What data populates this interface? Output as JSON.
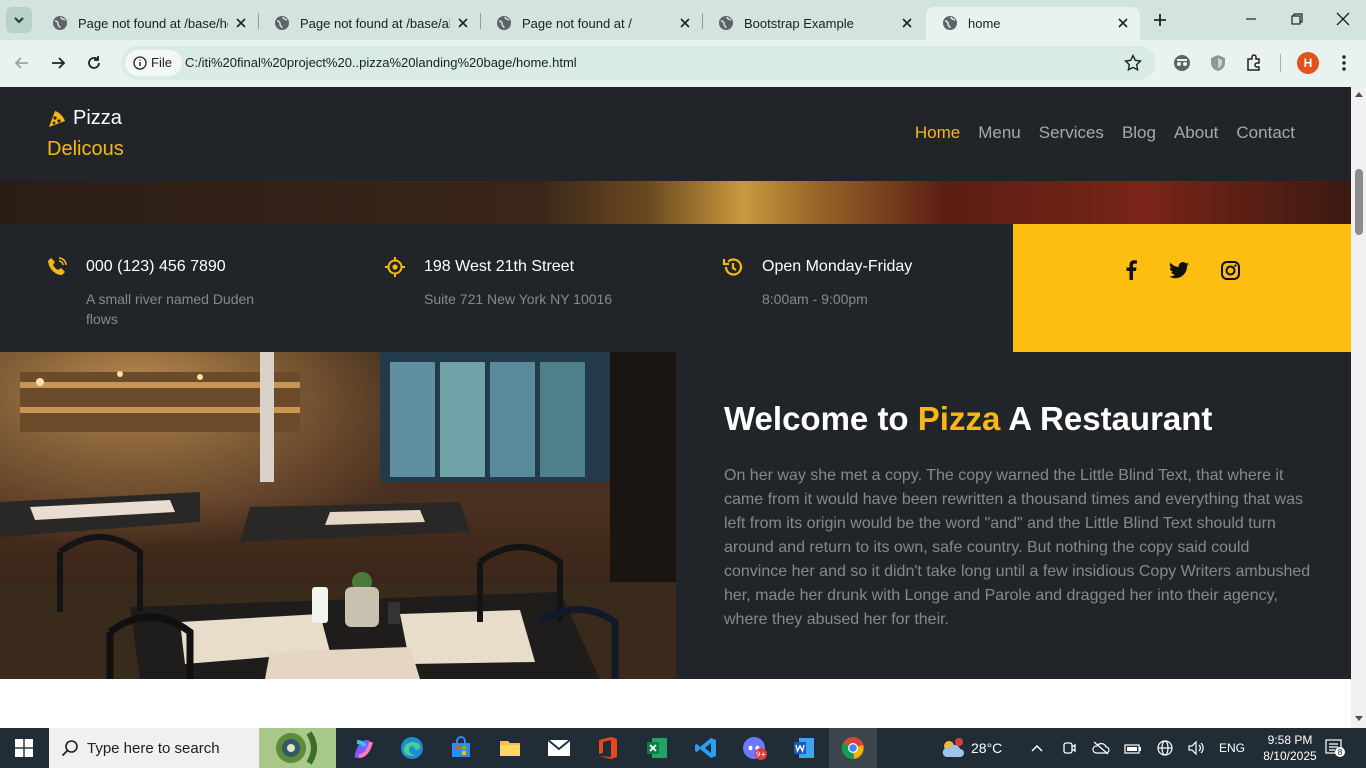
{
  "browser": {
    "tabs": [
      {
        "title": "Page not found at /base/ho"
      },
      {
        "title": "Page not found at /base/abo"
      },
      {
        "title": "Page not found at /"
      },
      {
        "title": "Bootstrap Example"
      },
      {
        "title": "home"
      }
    ],
    "file_chip": "File",
    "url": "C:/iti%20final%20project%20..pizza%20landing%20bage/home.html",
    "profile_initial": "H"
  },
  "site": {
    "brand": {
      "line1": "Pizza",
      "line2": "Delicous"
    },
    "menu": [
      {
        "label": "Home"
      },
      {
        "label": "Menu"
      },
      {
        "label": "Services"
      },
      {
        "label": "Blog"
      },
      {
        "label": "About"
      },
      {
        "label": "Contact"
      }
    ],
    "info": [
      {
        "title": "000 (123) 456 7890",
        "sub": "A small river named Duden flows",
        "icon": "phone-icon"
      },
      {
        "title": "198 West 21th Street",
        "sub": "Suite 721 New York NY 10016",
        "icon": "location-icon"
      },
      {
        "title": "Open Monday-Friday",
        "sub": "8:00am - 9:00pm",
        "icon": "clock-icon"
      }
    ],
    "about": {
      "title_pre": "Welcome to ",
      "title_highlight": "Pizza",
      "title_post": " A Restaurant",
      "body": "On her way she met a copy. The copy warned the Little Blind Text, that where it came from it would have been rewritten a thousand times and everything that was left from its origin would be the word \"and\" and the Little Blind Text should turn around and return to its own, safe country. But nothing the copy said could convince her and so it didn't take long until a few insidious Copy Writers ambushed her, made her drunk with Longe and Parole and dragged her into their agency, where they abused her for their."
    },
    "colors": {
      "accent": "#f7b718",
      "dark": "#212529",
      "social_bg": "#fdbe0f"
    }
  },
  "taskbar": {
    "search_placeholder": "Type here to search",
    "temperature": "28°C",
    "weather_badge": "1",
    "language": "ENG",
    "time": "9:58 PM",
    "date": "8/10/2025",
    "notification_count": "8",
    "discord_badge": "9+"
  }
}
